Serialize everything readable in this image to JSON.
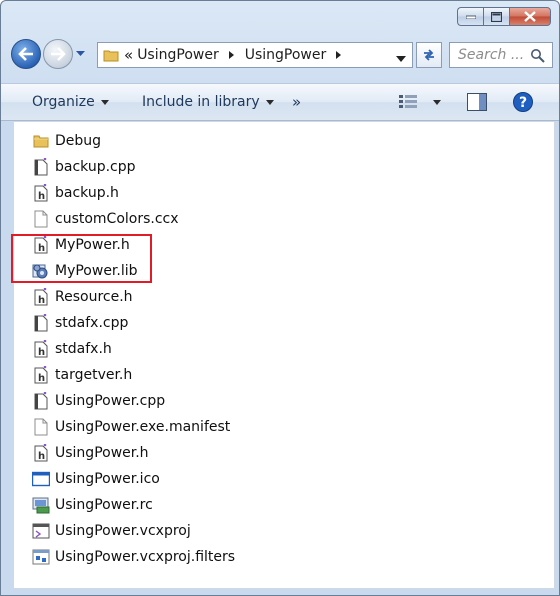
{
  "address": {
    "prefix": "«",
    "crumbs": [
      "UsingPower",
      "UsingPower"
    ]
  },
  "search": {
    "placeholder": "Search ..."
  },
  "toolbar": {
    "organize": "Organize",
    "include_in_library": "Include in library",
    "more": "»"
  },
  "files": [
    {
      "name": "Debug",
      "icon": "folder-icon"
    },
    {
      "name": "backup.cpp",
      "icon": "cpp-file-icon"
    },
    {
      "name": "backup.h",
      "icon": "header-file-icon"
    },
    {
      "name": "customColors.ccx",
      "icon": "blank-file-icon"
    },
    {
      "name": "MyPower.h",
      "icon": "header-file-icon"
    },
    {
      "name": "MyPower.lib",
      "icon": "lib-file-icon"
    },
    {
      "name": "Resource.h",
      "icon": "header-file-icon"
    },
    {
      "name": "stdafx.cpp",
      "icon": "cpp-file-icon"
    },
    {
      "name": "stdafx.h",
      "icon": "header-file-icon"
    },
    {
      "name": "targetver.h",
      "icon": "header-file-icon"
    },
    {
      "name": "UsingPower.cpp",
      "icon": "cpp-file-icon"
    },
    {
      "name": "UsingPower.exe.manifest",
      "icon": "blank-file-icon"
    },
    {
      "name": "UsingPower.h",
      "icon": "header-file-icon"
    },
    {
      "name": "UsingPower.ico",
      "icon": "ico-file-icon"
    },
    {
      "name": "UsingPower.rc",
      "icon": "rc-file-icon"
    },
    {
      "name": "UsingPower.vcxproj",
      "icon": "vcxproj-file-icon"
    },
    {
      "name": "UsingPower.vcxproj.filters",
      "icon": "filters-file-icon"
    }
  ],
  "highlight_color": "#e21b28"
}
